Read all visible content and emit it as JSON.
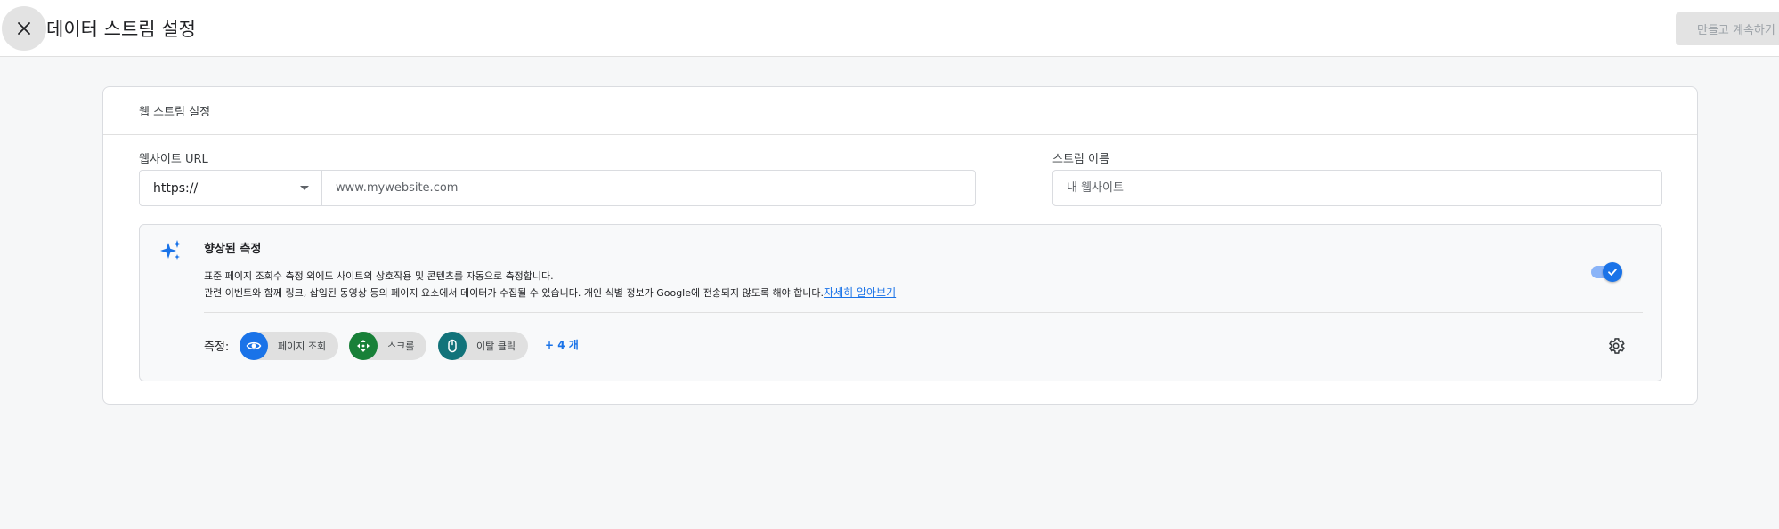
{
  "header": {
    "title": "데이터 스트림 설정",
    "close_icon": "close-icon",
    "create_button": "만들고 계속하기"
  },
  "card": {
    "title": "웹 스트림 설정",
    "website_url": {
      "label": "웹사이트 URL",
      "protocol": "https://",
      "placeholder": "www.mywebsite.com"
    },
    "stream_name": {
      "label": "스트림 이름",
      "placeholder": "내 웹사이트"
    },
    "enhanced_measurement": {
      "icon": "sparkle-icon",
      "title": "향상된 측정",
      "description_1": "표준 페이지 조회수 측정 외에도 사이트의 상호작용 및 콘텐츠를 자동으로 측정합니다.",
      "description_2": "관련 이벤트와 함께 링크, 삽입된 동영상 등의 페이지 요소에서 데이터가 수집될 수 있습니다. 개인 식별 정보가 Google에 전송되지 않도록 해야 합니다.",
      "learn_more": "자세히 알아보기",
      "enabled": true,
      "measurements_label": "측정:",
      "chips": [
        {
          "label": "페이지 조회",
          "icon": "eye-icon",
          "color": "#1a73e8"
        },
        {
          "label": "스크롤",
          "icon": "scroll-icon",
          "color": "#188038"
        },
        {
          "label": "이탈 클릭",
          "icon": "mouse-icon",
          "color": "#12737a"
        }
      ],
      "more": "+ 4 개",
      "settings_icon": "gear-icon"
    }
  },
  "colors": {
    "accent": "#1a73e8",
    "background": "#f6f7f8"
  }
}
